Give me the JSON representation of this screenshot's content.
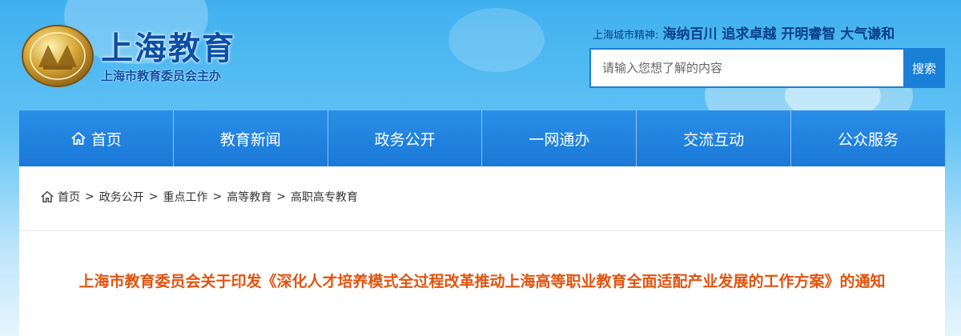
{
  "header": {
    "site_title": "上海教育",
    "site_subtitle": "上海市教育委员会主办",
    "motto_label": "上海城市精神:",
    "motto_text": "海纳百川 追求卓越 开明睿智 大气谦和"
  },
  "search": {
    "placeholder": "请输入您想了解的内容",
    "button_label": "搜索"
  },
  "nav": {
    "items": [
      {
        "label": "首页",
        "icon": "home-icon"
      },
      {
        "label": "教育新闻"
      },
      {
        "label": "政务公开"
      },
      {
        "label": "一网通办"
      },
      {
        "label": "交流互动"
      },
      {
        "label": "公众服务"
      }
    ]
  },
  "breadcrumb": {
    "icon": "home-icon",
    "items": [
      "首页",
      "政务公开",
      "重点工作",
      "高等教育",
      "高职高专教育"
    ],
    "separator": ">"
  },
  "article": {
    "title": "上海市教育委员会关于印发《深化人才培养模式全过程改革推动上海高等职业教育全面适配产业发展的工作方案》的通知"
  },
  "colors": {
    "nav_bg": "#1a78d6",
    "title_color": "#e2530e",
    "brand_blue": "#0b4fa6"
  }
}
